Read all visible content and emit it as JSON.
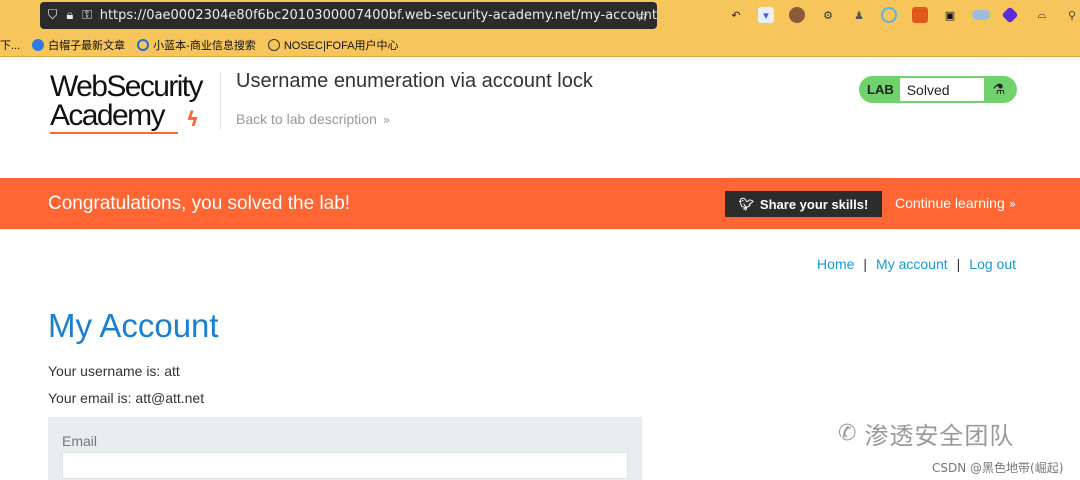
{
  "browser": {
    "url": "https://0ae0002304e80f6bc2010300007400bf.web-security-academy.net/my-account",
    "icons": [
      "shield-icon",
      "lock-icon",
      "key-icon",
      "star-icon"
    ]
  },
  "bookmarks": [
    {
      "label": "下...",
      "icon_color": ""
    },
    {
      "label": "白帽子最新文章",
      "icon_color": "#2f7be0"
    },
    {
      "label": "小蓝本-商业信息搜索",
      "icon_color": "#1e6fd9"
    },
    {
      "label": "NOSEC|FOFA用户中心",
      "icon_color": "#333333"
    }
  ],
  "header": {
    "logo_line1": "WebSecurity",
    "logo_line2": "Academy",
    "lab_title": "Username enumeration via account lock",
    "back_link": "Back to lab description",
    "badge_lab": "LAB",
    "badge_status": "Solved"
  },
  "banner": {
    "message": "Congratulations, you solved the lab!",
    "share_label": "Share your skills!",
    "continue_label": "Continue learning"
  },
  "nav": {
    "home": "Home",
    "my_account": "My account",
    "log_out": "Log out",
    "separator": "|"
  },
  "account": {
    "heading": "My Account",
    "username_line": "Your username is: att",
    "email_line": "Your email is: att@att.net",
    "email_label": "Email",
    "email_value": ""
  },
  "watermark": {
    "text": "渗透安全团队",
    "credit": "CSDN @黑色地带(崛起)"
  },
  "colors": {
    "accent_orange": "#ff6633",
    "link_blue": "#1a9acf",
    "heading_blue": "#1a7fcf",
    "solved_green": "#70d16d",
    "browser_yellow": "#f6c55b"
  }
}
